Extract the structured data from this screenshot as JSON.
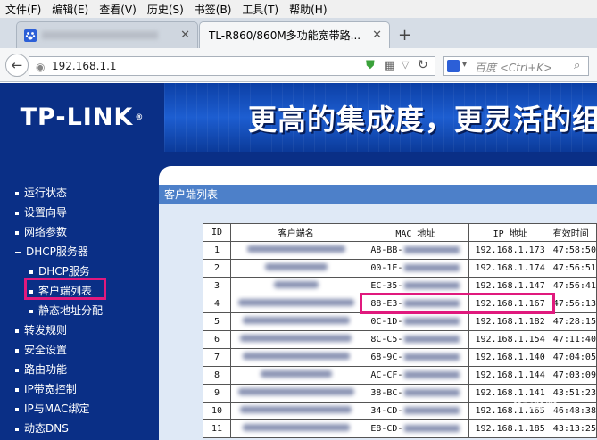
{
  "menubar": {
    "items": [
      "文件(F)",
      "编辑(E)",
      "查看(V)",
      "历史(S)",
      "书签(B)",
      "工具(T)",
      "帮助(H)"
    ]
  },
  "tabs": [
    {
      "label": "",
      "active": false,
      "favicon": "paw-icon"
    },
    {
      "label": "TL-R860/860M多功能宽带路...",
      "active": true,
      "favicon": ""
    }
  ],
  "navbar": {
    "url": "192.168.1.1",
    "search_placeholder": "百度 <Ctrl+K>"
  },
  "banner": {
    "logo": "TP-LINK",
    "logo_mark": "®",
    "slogan": "更高的集成度，更灵活的组"
  },
  "sidebar": {
    "items": [
      {
        "label": "运行状态"
      },
      {
        "label": "设置向导"
      },
      {
        "label": "网络参数"
      },
      {
        "label": "DHCP服务器"
      },
      {
        "label": "DHCP服务"
      },
      {
        "label": "客户端列表"
      },
      {
        "label": "静态地址分配"
      },
      {
        "label": "转发规则"
      },
      {
        "label": "安全设置"
      },
      {
        "label": "路由功能"
      },
      {
        "label": "IP带宽控制"
      },
      {
        "label": "IP与MAC绑定"
      },
      {
        "label": "动态DNS"
      }
    ]
  },
  "panel": {
    "title": "客户端列表",
    "table": {
      "headers": [
        "ID",
        "客户端名",
        "MAC 地址",
        "IP 地址",
        "有效时间"
      ],
      "rows": [
        {
          "id": "1",
          "mac": "A8-BB-",
          "ip": "192.168.1.173",
          "time": "47:58:50"
        },
        {
          "id": "2",
          "mac": "00-1E-",
          "ip": "192.168.1.174",
          "time": "47:56:51"
        },
        {
          "id": "3",
          "mac": "EC-35-",
          "ip": "192.168.1.147",
          "time": "47:56:41"
        },
        {
          "id": "4",
          "mac": "88-E3-",
          "ip": "192.168.1.167",
          "time": "47:56:13"
        },
        {
          "id": "5",
          "mac": "0C-1D-",
          "ip": "192.168.1.182",
          "time": "47:28:15"
        },
        {
          "id": "6",
          "mac": "8C-C5-",
          "ip": "192.168.1.154",
          "time": "47:11:40"
        },
        {
          "id": "7",
          "mac": "68-9C-",
          "ip": "192.168.1.140",
          "time": "47:04:05"
        },
        {
          "id": "8",
          "mac": "AC-CF-",
          "ip": "192.168.1.144",
          "time": "47:03:09"
        },
        {
          "id": "9",
          "mac": "38-BC-",
          "ip": "192.168.1.141",
          "time": "43:51:23"
        },
        {
          "id": "10",
          "mac": "34-CD-",
          "ip": "192.168.1.165",
          "time": "46:48:38"
        },
        {
          "id": "11",
          "mac": "E8-CD-",
          "ip": "192.168.1.185",
          "time": "43:13:25"
        }
      ]
    }
  },
  "watermark": "Bai经验",
  "colors": {
    "brand_blue": "#0a2f86",
    "header_blue": "#4d80c9",
    "highlight": "#e0197d"
  }
}
